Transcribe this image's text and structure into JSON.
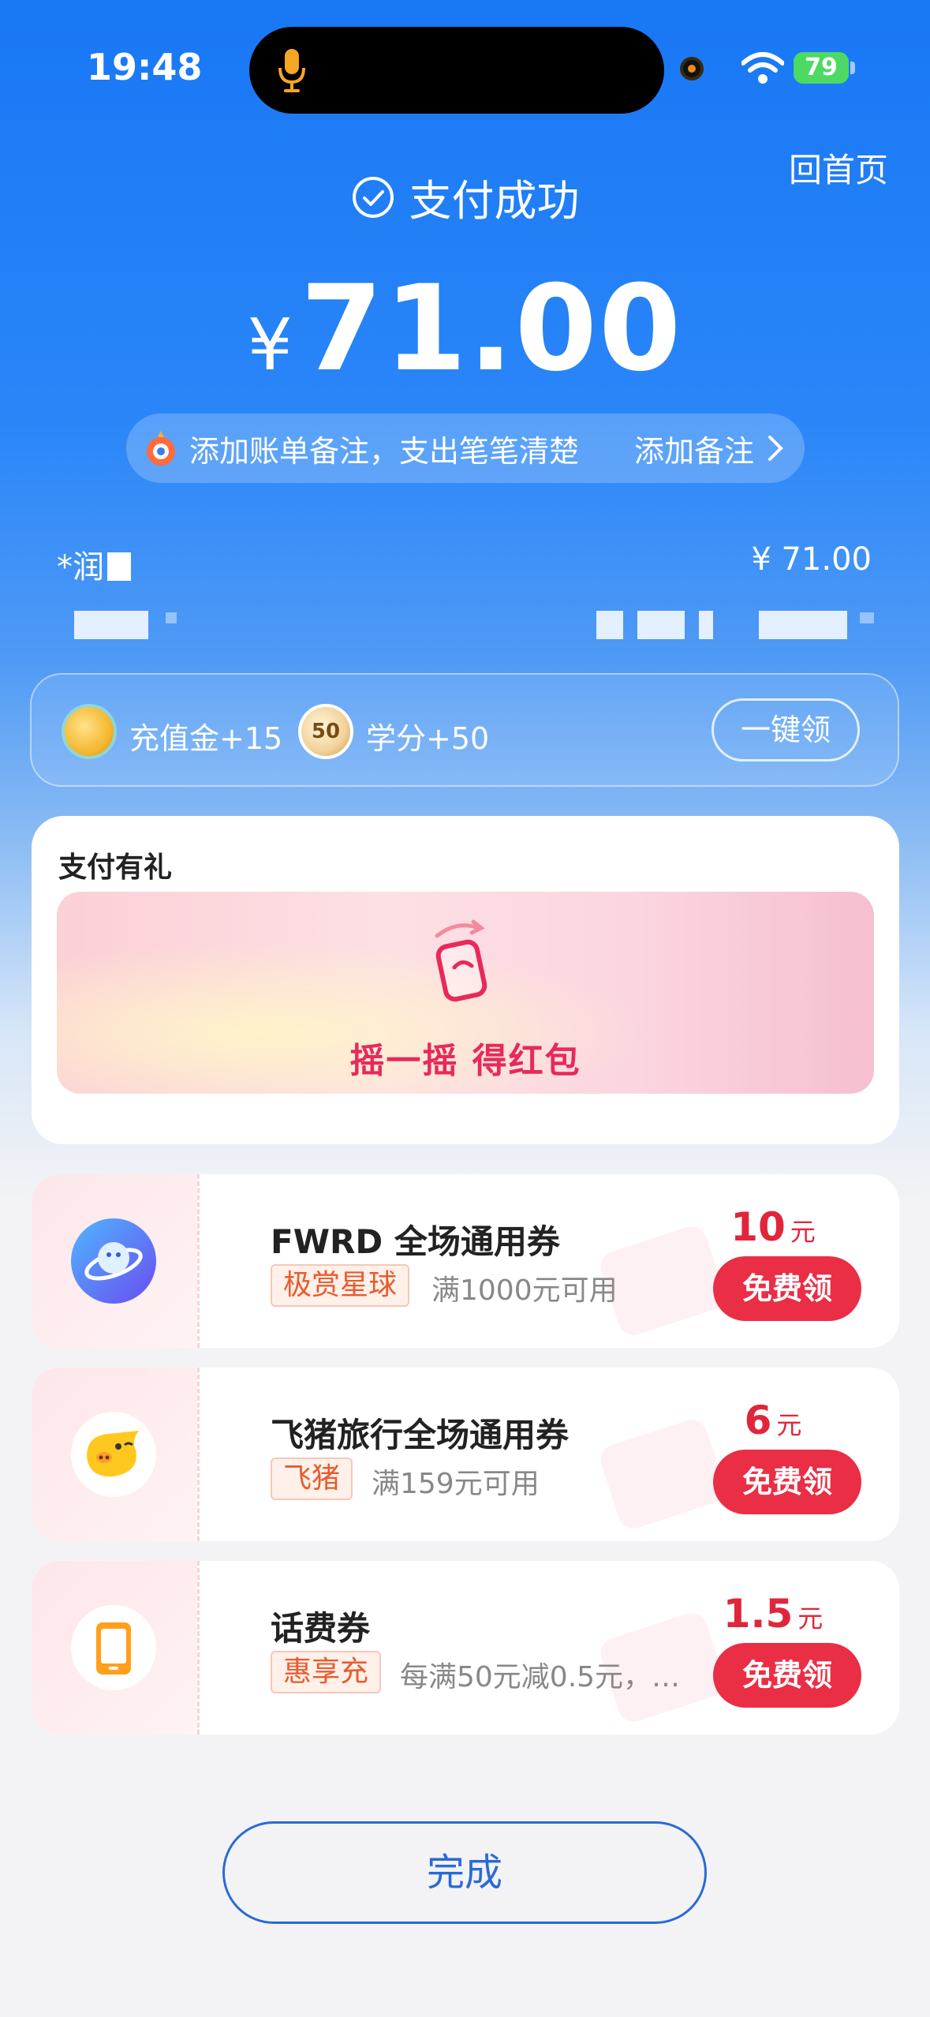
{
  "status_bar": {
    "time": "19:48",
    "battery": "79"
  },
  "header": {
    "home_link": "回首页",
    "success_text": "支付成功",
    "currency": "¥",
    "amount": "71.00"
  },
  "note_banner": {
    "text": "添加账单备注，支出笔笔清楚",
    "action": "添加备注"
  },
  "payment": {
    "payee": "*润",
    "amount": "¥ 71.00"
  },
  "rewards": {
    "items": [
      {
        "label": "充值金+15",
        "icon": "gold-coin-icon"
      },
      {
        "label": "学分+50",
        "icon": "credit-badge-icon",
        "badge": "50"
      }
    ],
    "claim_all": "一键领"
  },
  "gift_section": {
    "title": "支付有礼",
    "banner_text": "摇一摇 得红包"
  },
  "coupons": [
    {
      "title": "FWRD 全场通用券",
      "tag": "极赏星球",
      "desc": "满1000元可用",
      "value": "10",
      "unit": "元",
      "button": "免费领",
      "logo": "planet-logo-icon"
    },
    {
      "title": "飞猪旅行全场通用券",
      "tag": "飞猪",
      "desc": "满159元可用",
      "value": "6",
      "unit": "元",
      "button": "免费领",
      "logo": "fliggy-pig-logo-icon"
    },
    {
      "title": "话费券",
      "tag": "惠享充",
      "desc": "每满50元减0.5元，…",
      "value": "1.5",
      "unit": "元",
      "button": "免费领",
      "logo": "phone-topup-icon"
    }
  ],
  "footer": {
    "done_button": "完成"
  },
  "colors": {
    "brand_blue": "#1877f5",
    "red": "#ea2e45",
    "tag_orange": "#e85b2c"
  }
}
